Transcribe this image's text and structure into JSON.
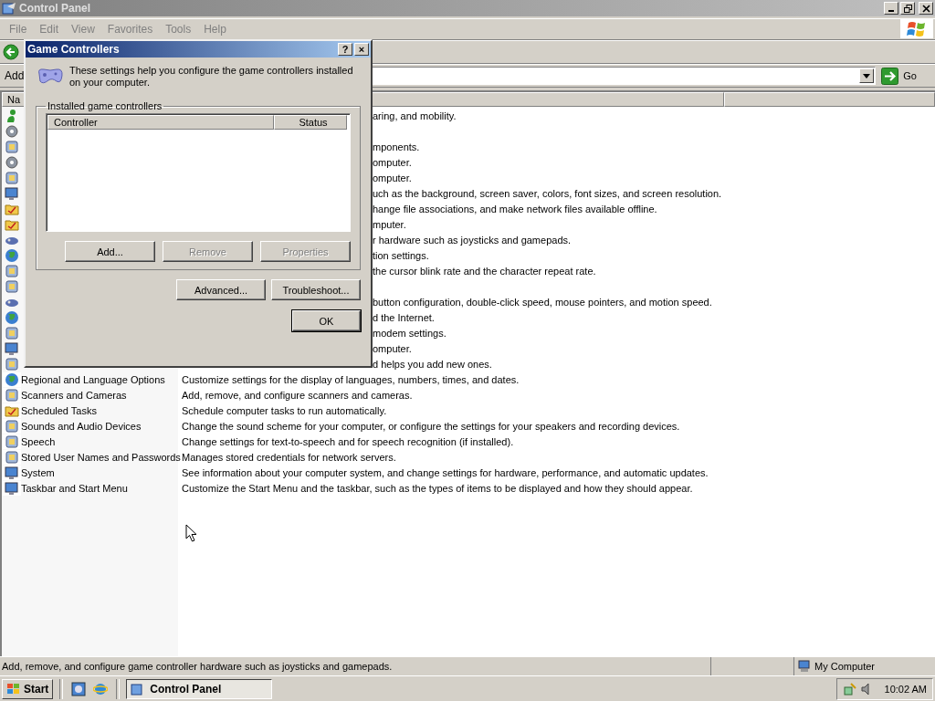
{
  "window": {
    "title": "Control Panel",
    "active": false
  },
  "menu": [
    {
      "label": "File",
      "disabled": true
    },
    {
      "label": "Edit",
      "disabled": true
    },
    {
      "label": "View",
      "disabled": true
    },
    {
      "label": "Favorites",
      "disabled": true
    },
    {
      "label": "Tools",
      "disabled": true
    },
    {
      "label": "Help",
      "disabled": true
    }
  ],
  "address_bar": {
    "label": "Add",
    "go": "Go"
  },
  "list": {
    "columns": [
      "Na"
    ],
    "rows": [
      {
        "kind": "row",
        "description": "aring, and mobility."
      },
      {
        "kind": "icon"
      },
      {
        "kind": "row",
        "description": "mponents."
      },
      {
        "kind": "row",
        "description": "omputer."
      },
      {
        "kind": "row",
        "description": "omputer."
      },
      {
        "kind": "row",
        "description": "uch as the background, screen saver, colors, font sizes, and screen resolution."
      },
      {
        "kind": "row",
        "description": "hange file associations, and make network files available offline."
      },
      {
        "kind": "row",
        "description": "mputer."
      },
      {
        "kind": "row",
        "description": "r hardware such as joysticks and gamepads."
      },
      {
        "kind": "row",
        "description": "tion settings."
      },
      {
        "kind": "row",
        "description": "the cursor blink rate and the character repeat rate."
      },
      {
        "kind": "icon"
      },
      {
        "kind": "row",
        "description": "button configuration, double-click speed, mouse pointers, and motion speed."
      },
      {
        "kind": "row",
        "description": "d the Internet."
      },
      {
        "kind": "row",
        "description": "modem settings."
      },
      {
        "kind": "row",
        "description": "omputer."
      },
      {
        "kind": "row",
        "description": "d helps you add new ones."
      },
      {
        "kind": "row",
        "name": "Regional and Language Options",
        "description": "Customize settings for the display of languages, numbers, times, and dates."
      },
      {
        "kind": "row",
        "name": "Scanners and Cameras",
        "description": "Add, remove, and configure scanners and cameras."
      },
      {
        "kind": "row",
        "name": "Scheduled Tasks",
        "description": "Schedule computer tasks to run automatically."
      },
      {
        "kind": "row",
        "name": "Sounds and Audio Devices",
        "description": "Change the sound scheme for your computer, or configure the settings for your speakers and recording devices."
      },
      {
        "kind": "row",
        "name": "Speech",
        "description": "Change settings for text-to-speech and for speech recognition (if installed)."
      },
      {
        "kind": "row",
        "name": "Stored User Names and Passwords",
        "description": "Manages stored credentials for network servers."
      },
      {
        "kind": "row",
        "name": "System",
        "description": "See information about your computer system, and change settings for hardware, performance, and automatic updates."
      },
      {
        "kind": "row",
        "name": "Taskbar and Start Menu",
        "description": "Customize the Start Menu and the taskbar, such as the types of items to be displayed and how they should appear."
      }
    ]
  },
  "status_bar": {
    "text": "Add, remove, and configure game controller hardware such as joysticks and gamepads.",
    "zone": "My Computer"
  },
  "dialog": {
    "title": "Game Controllers",
    "help": "?",
    "close": "×",
    "intro": "These settings help you configure the game controllers installed on your computer.",
    "group": "Installed game controllers",
    "columns": [
      "Controller",
      "Status"
    ],
    "list_buttons": [
      {
        "label": "Add...",
        "disabled": false
      },
      {
        "label": "Remove",
        "disabled": true
      },
      {
        "label": "Properties",
        "disabled": true
      }
    ],
    "buttons": [
      {
        "label": "Advanced...",
        "disabled": false
      },
      {
        "label": "Troubleshoot...",
        "disabled": false
      }
    ],
    "ok": {
      "label": "OK",
      "default": true
    }
  },
  "taskbar": {
    "start": "Start",
    "tasks": [
      {
        "label": "Control Panel",
        "selected": true
      }
    ],
    "clock": "10:02 AM"
  }
}
